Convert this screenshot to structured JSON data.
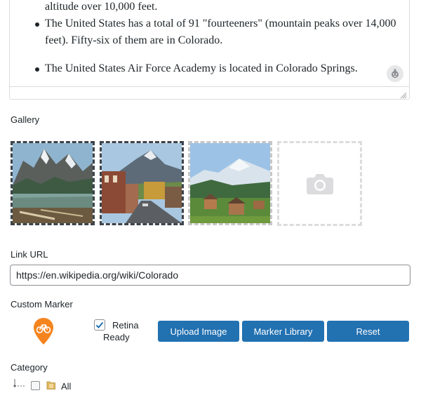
{
  "editor": {
    "fragment_line": "altitude over 10,000 feet.",
    "bullets": [
      "The United States has a total of 91 \"fourteeners\" (mountain peaks over 14,000 feet). Fifty-six of them are in Colorado.",
      "The United States Air Force Academy is located in Colorado Springs."
    ]
  },
  "gallery": {
    "label": "Gallery",
    "images": [
      {
        "name": "alpine-lake"
      },
      {
        "name": "mountain-town-street"
      },
      {
        "name": "snowy-peak-village"
      }
    ],
    "add_icon": "camera-icon"
  },
  "link": {
    "label": "Link URL",
    "value": "https://en.wikipedia.org/wiki/Colorado"
  },
  "marker": {
    "label": "Custom Marker",
    "icon": "bicycle-marker-icon",
    "color": "#f5841f",
    "retina_line1": "Retina",
    "retina_line2": "Ready",
    "retina_checked": true,
    "buttons": {
      "upload": "Upload Image",
      "library": "Marker Library",
      "reset": "Reset"
    }
  },
  "category": {
    "label": "Category",
    "items": [
      {
        "label": "All",
        "checked": false
      }
    ]
  },
  "colors": {
    "button": "#2271b1",
    "border": "#dcdcde",
    "text": "#1d2327"
  }
}
